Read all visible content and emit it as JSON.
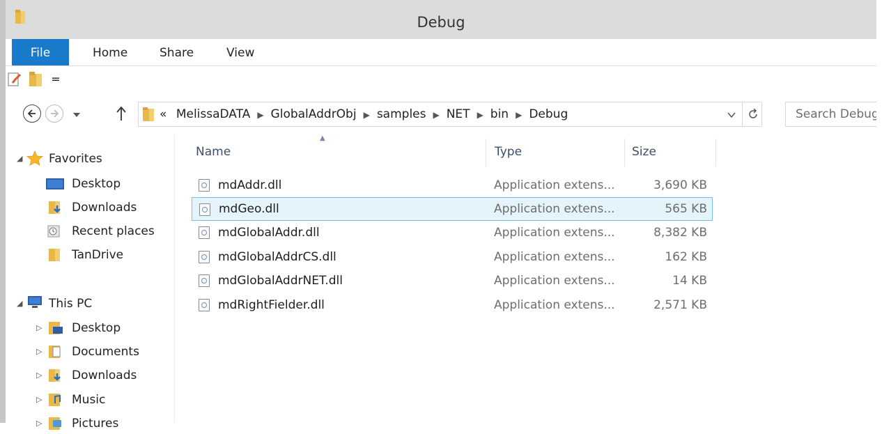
{
  "window": {
    "title": "Debug"
  },
  "ribbon": {
    "tabs": [
      "File",
      "Home",
      "Share",
      "View"
    ]
  },
  "quick_access": {
    "dropdown": "="
  },
  "address_bar": {
    "overflow": "«",
    "crumbs": [
      "MelissaDATA",
      "GlobalAddrObj",
      "samples",
      "NET",
      "bin",
      "Debug"
    ],
    "search_placeholder": "Search Debug"
  },
  "nav_pane": {
    "favorites": {
      "label": "Favorites",
      "items": [
        "Desktop",
        "Downloads",
        "Recent places",
        "TanDrive"
      ]
    },
    "this_pc": {
      "label": "This PC",
      "items": [
        "Desktop",
        "Documents",
        "Downloads",
        "Music",
        "Pictures"
      ]
    }
  },
  "file_list": {
    "columns": {
      "name": "Name",
      "type": "Type",
      "size": "Size"
    },
    "sort_indicator": "▲",
    "rows": [
      {
        "name": "mdAddr.dll",
        "type": "Application extens...",
        "size": "3,690 KB"
      },
      {
        "name": "mdGeo.dll",
        "type": "Application extens...",
        "size": "565 KB",
        "selected": true
      },
      {
        "name": "mdGlobalAddr.dll",
        "type": "Application extens...",
        "size": "8,382 KB"
      },
      {
        "name": "mdGlobalAddrCS.dll",
        "type": "Application extens...",
        "size": "162 KB"
      },
      {
        "name": "mdGlobalAddrNET.dll",
        "type": "Application extens...",
        "size": "14 KB"
      },
      {
        "name": "mdRightFielder.dll",
        "type": "Application extens...",
        "size": "2,571 KB"
      }
    ]
  },
  "colors": {
    "accent": "#1979ca",
    "selection_bg": "#e5f3fb",
    "selection_border": "#70c0e7",
    "folder": "#e8b84a"
  }
}
